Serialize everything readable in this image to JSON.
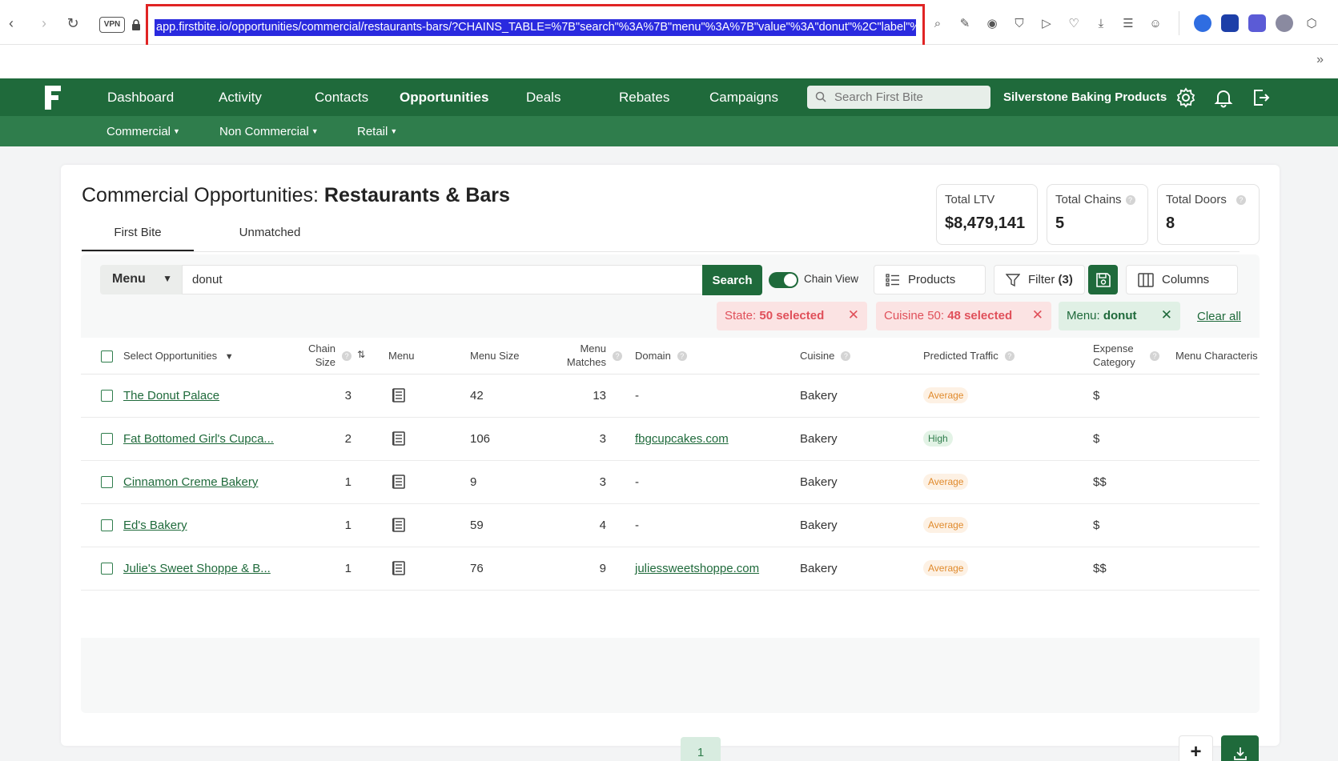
{
  "browser": {
    "vpn_label": "VPN",
    "url": "app.firstbite.io/opportunities/commercial/restaurants-bars/?CHAINS_TABLE=%7B\"search\"%3A%7B\"menu\"%3A%7B\"value\"%3A\"donut\"%2C\"label\"%",
    "more_label": "»"
  },
  "nav": {
    "items": [
      "Dashboard",
      "Activity",
      "Contacts",
      "Opportunities",
      "Deals",
      "Rebates",
      "Campaigns"
    ],
    "active": "Opportunities",
    "search_placeholder": "Search First Bite",
    "company": "Silverstone Baking Products",
    "sub_items": [
      "Commercial",
      "Non Commercial",
      "Retail"
    ]
  },
  "page": {
    "title_prefix": "Commercial Opportunities: ",
    "title_bold": "Restaurants & Bars",
    "tabs": [
      "First Bite",
      "Unmatched"
    ],
    "active_tab": "First Bite"
  },
  "stats": [
    {
      "label": "Total LTV",
      "value": "$8,479,141"
    },
    {
      "label": "Total Chains",
      "value": "5"
    },
    {
      "label": "Total Doors",
      "value": "8"
    }
  ],
  "toolbar": {
    "search_field": "Menu",
    "query": "donut",
    "search_label": "Search",
    "chain_view_label": "Chain View",
    "chain_view_on": true,
    "products_label": "Products",
    "filter_label": "Filter",
    "filter_count": "(3)",
    "columns_label": "Columns"
  },
  "chips": [
    {
      "prefix": "State: ",
      "bold": "50 selected",
      "color": "red"
    },
    {
      "prefix": "Cuisine 50: ",
      "bold": "48 selected",
      "color": "red"
    },
    {
      "prefix": "Menu: ",
      "bold": "donut",
      "color": "green"
    }
  ],
  "clear_all": "Clear all",
  "table": {
    "headers": {
      "select": "Select Opportunities",
      "chain_size_1": "Chain",
      "chain_size_2": "Size",
      "menu": "Menu",
      "menu_size": "Menu Size",
      "menu_matches_1": "Menu",
      "menu_matches_2": "Matches",
      "domain": "Domain",
      "cuisine": "Cuisine",
      "traffic": "Predicted Traffic",
      "expense_1": "Expense",
      "expense_2": "Category",
      "menu_char": "Menu Characteris"
    },
    "rows": [
      {
        "name": "The Donut Palace",
        "chain_size": "3",
        "menu_size": "42",
        "matches": "13",
        "domain": "-",
        "cuisine": "Bakery",
        "traffic": "Average",
        "expense": "$"
      },
      {
        "name": "Fat Bottomed Girl's Cupca...",
        "chain_size": "2",
        "menu_size": "106",
        "matches": "3",
        "domain": "fbgcupcakes.com",
        "cuisine": "Bakery",
        "traffic": "High",
        "expense": "$"
      },
      {
        "name": "Cinnamon Creme Bakery",
        "chain_size": "1",
        "menu_size": "9",
        "matches": "3",
        "domain": "-",
        "cuisine": "Bakery",
        "traffic": "Average",
        "expense": "$$"
      },
      {
        "name": "Ed's Bakery",
        "chain_size": "1",
        "menu_size": "59",
        "matches": "4",
        "domain": "-",
        "cuisine": "Bakery",
        "traffic": "Average",
        "expense": "$"
      },
      {
        "name": "Julie's Sweet Shoppe & B...",
        "chain_size": "1",
        "menu_size": "76",
        "matches": "9",
        "domain": "juliessweetshoppe.com",
        "cuisine": "Bakery",
        "traffic": "Average",
        "expense": "$$"
      }
    ]
  },
  "pagination": {
    "current": "1"
  },
  "actions": {
    "add_label": "+"
  },
  "colors": {
    "brand": "#1f6a3b",
    "accent_red": "#e0505a",
    "url_highlight": "#2a2adf"
  }
}
